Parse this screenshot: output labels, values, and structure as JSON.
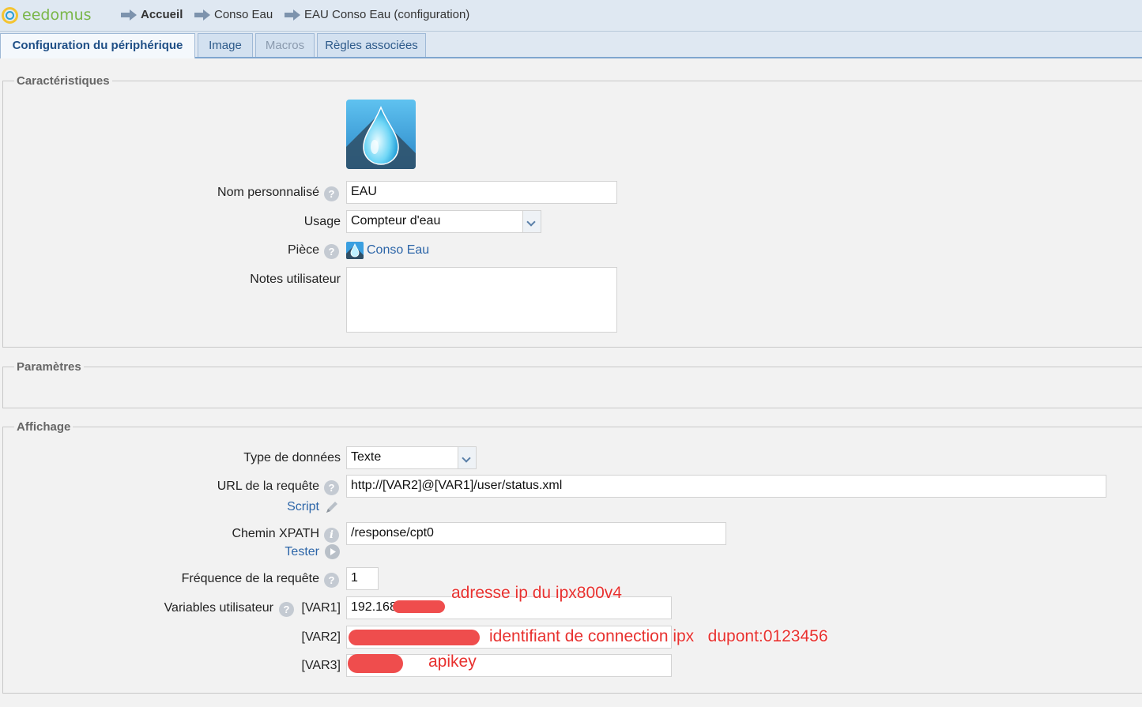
{
  "header": {
    "logo_text": "eedomus",
    "breadcrumbs": [
      "Accueil",
      "Conso Eau",
      "EAU Conso Eau (configuration)"
    ]
  },
  "tabs": [
    {
      "label": "Configuration du périphérique",
      "state": "active"
    },
    {
      "label": "Image",
      "state": "normal"
    },
    {
      "label": "Macros",
      "state": "disabled"
    },
    {
      "label": "Règles associées",
      "state": "normal"
    }
  ],
  "caracteristiques": {
    "legend": "Caractéristiques",
    "device_icon": "water-drop-icon",
    "nom_label": "Nom personnalisé",
    "nom_value": "EAU",
    "usage_label": "Usage",
    "usage_value": "Compteur d'eau",
    "piece_label": "Pièce",
    "piece_value": "Conso Eau",
    "notes_label": "Notes utilisateur",
    "notes_value": ""
  },
  "parametres": {
    "legend": "Paramètres"
  },
  "affichage": {
    "legend": "Affichage",
    "type_label": "Type de données",
    "type_value": "Texte",
    "url_label": "URL de la requête",
    "url_value": "http://[VAR2]@[VAR1]/user/status.xml",
    "script_link": "Script",
    "xpath_label": "Chemin XPATH",
    "xpath_value": "/response/cpt0",
    "tester_link": "Tester",
    "freq_label": "Fréquence de la requête",
    "freq_value": "1",
    "vars_label": "Variables utilisateur",
    "var1_label": "[VAR1]",
    "var1_value": "192.168",
    "var2_label": "[VAR2]",
    "var2_value": "",
    "var3_label": "[VAR3]",
    "var3_value": ""
  },
  "annotations": {
    "var1_note": "adresse ip du ipx800v4",
    "var2_note": "identifiant de connection ipx   dupont:0123456",
    "var3_note": "apikey"
  },
  "colors": {
    "accent": "#2c65a8",
    "annotation": "#e8312f",
    "redaction": "#ef4d4d"
  }
}
